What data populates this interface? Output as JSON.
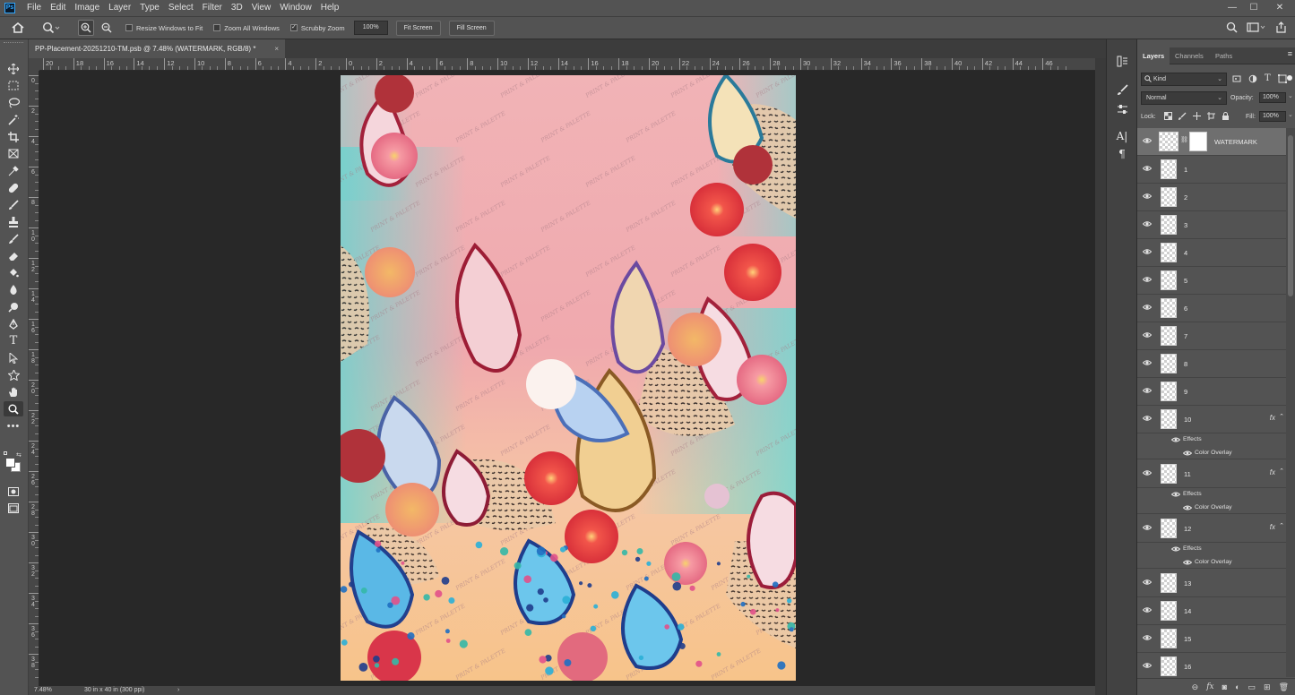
{
  "app": {
    "logo": "Ps"
  },
  "menu": [
    "File",
    "Edit",
    "Image",
    "Layer",
    "Type",
    "Select",
    "Filter",
    "3D",
    "View",
    "Window",
    "Help"
  ],
  "window_controls": {
    "minimize": "—",
    "maximize": "☐",
    "close": "✕"
  },
  "options_bar": {
    "resize_windows_label": "Resize Windows to Fit",
    "zoom_all_label": "Zoom All Windows",
    "scrubby_zoom_label": "Scrubby Zoom",
    "scrubby_checked": true,
    "zoom_value": "100%",
    "fit_screen_label": "Fit Screen",
    "fill_screen_label": "Fill Screen"
  },
  "document": {
    "tab_title": "PP-Placement-20251210-TM.psb @ 7.48% (WATERMARK, RGB/8) *",
    "close": "×",
    "watermark_text": "PRINT & PALETTE"
  },
  "ruler_h": [
    "20",
    "18",
    "16",
    "14",
    "12",
    "10",
    "8",
    "6",
    "4",
    "2",
    "0",
    "2",
    "4",
    "6",
    "8",
    "10",
    "12",
    "14",
    "16",
    "18",
    "20",
    "22",
    "24",
    "26",
    "28",
    "30",
    "32",
    "34",
    "36",
    "38",
    "40",
    "42",
    "44",
    "46"
  ],
  "ruler_v": [
    "0",
    "2",
    "4",
    "6",
    "8",
    "10",
    "12",
    "14",
    "16",
    "18",
    "20",
    "22",
    "24",
    "26",
    "28",
    "30",
    "32",
    "34",
    "36",
    "38"
  ],
  "status": {
    "zoom": "7.48%",
    "doc_size": "30 in x 40 in (300 ppi)",
    "arrow": "›"
  },
  "colors": {
    "accent": "#31a8ff",
    "chrome": "#535353",
    "canvas_bg": "#282828"
  },
  "panel": {
    "tabs": [
      "Layers",
      "Channels",
      "Paths"
    ],
    "kind_label": "Kind",
    "blend_mode": "Normal",
    "opacity_label": "Opacity:",
    "opacity_value": "100%",
    "lock_label": "Lock:",
    "fill_label": "Fill:",
    "fill_value": "100%",
    "effects_label": "Effects",
    "color_overlay_label": "Color Overlay",
    "layers": [
      {
        "name": "WATERMARK",
        "selected": true,
        "fx": false,
        "mask": true
      },
      {
        "name": "1",
        "fx": false
      },
      {
        "name": "2",
        "fx": false
      },
      {
        "name": "3",
        "fx": false
      },
      {
        "name": "4",
        "fx": false
      },
      {
        "name": "5",
        "fx": false
      },
      {
        "name": "6",
        "fx": false
      },
      {
        "name": "7",
        "fx": false
      },
      {
        "name": "8",
        "fx": false
      },
      {
        "name": "9",
        "fx": false
      },
      {
        "name": "10",
        "fx": true
      },
      {
        "name": "11",
        "fx": true
      },
      {
        "name": "12",
        "fx": true
      },
      {
        "name": "13",
        "fx": false
      },
      {
        "name": "14",
        "fx": false
      },
      {
        "name": "15",
        "fx": false
      },
      {
        "name": "16",
        "fx": false
      }
    ]
  }
}
